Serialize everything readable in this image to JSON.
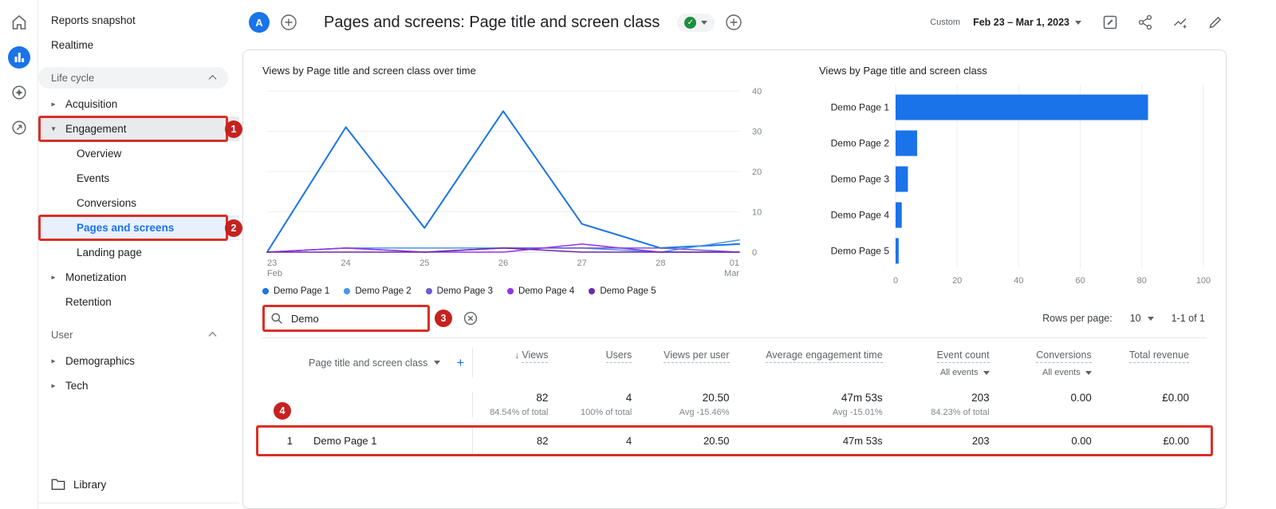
{
  "colors": {
    "blue": "#1a73e8",
    "light_blue_bg": "#e8f0fe",
    "selected_gray": "#e8eaed",
    "annotation_box_red": "#d93025",
    "annotation_badge_red": "#c5221f",
    "green": "#1e8e3e",
    "text": "#202124",
    "muted": "#5f6368",
    "series": [
      "#1a73e8",
      "#4797e8",
      "#6f5bd0",
      "#9334e6",
      "#6d28a8"
    ]
  },
  "icons": {
    "check": "✓",
    "plus": "+",
    "sort_desc": "↓",
    "triangle_right": "▸",
    "triangle_down": "▾"
  },
  "rail": {
    "icons": [
      "home-icon",
      "reports-icon",
      "explore-icon",
      "advertising-icon"
    ]
  },
  "sidebar": {
    "reports_snapshot": "Reports snapshot",
    "realtime": "Realtime",
    "life_cycle": "Life cycle",
    "acquisition": "Acquisition",
    "engagement": "Engagement",
    "overview": "Overview",
    "events": "Events",
    "conversions": "Conversions",
    "pages_and_screens": "Pages and screens",
    "landing_page": "Landing page",
    "monetization": "Monetization",
    "retention": "Retention",
    "user": "User",
    "demographics": "Demographics",
    "tech": "Tech",
    "library": "Library"
  },
  "header": {
    "avatar_letter": "A",
    "title": "Pages and screens: Page title and screen class",
    "date_label": "Custom",
    "date_range": "Feb 23 – Mar 1, 2023"
  },
  "chart_data": [
    {
      "type": "line",
      "title": "Views by Page title and screen class over time",
      "x": [
        "23 Feb",
        "24",
        "25",
        "26",
        "27",
        "28",
        "01 Mar"
      ],
      "x_tick_labels": [
        [
          "23",
          "Feb"
        ],
        [
          "24"
        ],
        [
          "25"
        ],
        [
          "26"
        ],
        [
          "27"
        ],
        [
          "28"
        ],
        [
          "01",
          "Mar"
        ]
      ],
      "ylim": [
        0,
        40
      ],
      "yticks": [
        0,
        10,
        20,
        30,
        40
      ],
      "grid": true,
      "legend_position": "bottom",
      "series": [
        {
          "name": "Demo Page 1",
          "values": [
            0,
            31,
            6,
            35,
            7,
            1,
            2
          ]
        },
        {
          "name": "Demo Page 2",
          "values": [
            0,
            1,
            1,
            1,
            1,
            0,
            3
          ]
        },
        {
          "name": "Demo Page 3",
          "values": [
            0,
            1,
            0,
            1,
            1,
            1,
            0
          ]
        },
        {
          "name": "Demo Page 4",
          "values": [
            0,
            1,
            0,
            0,
            2,
            0,
            0
          ]
        },
        {
          "name": "Demo Page 5",
          "values": [
            0,
            0,
            0,
            1,
            0,
            0,
            0
          ]
        }
      ]
    },
    {
      "type": "bar",
      "orientation": "horizontal",
      "title": "Views by Page title and screen class",
      "categories": [
        "Demo Page 1",
        "Demo Page 2",
        "Demo Page 3",
        "Demo Page 4",
        "Demo Page 5"
      ],
      "values": [
        82,
        7,
        4,
        2,
        1
      ],
      "xlim": [
        0,
        100
      ],
      "xticks": [
        0,
        20,
        40,
        60,
        80,
        100
      ],
      "grid": true
    }
  ],
  "table": {
    "search_value": "Demo",
    "rows_per_page_label": "Rows per page:",
    "rows_per_page_value": "10",
    "pagination": "1-1 of 1",
    "dimension_header": "Page title and screen class",
    "columns": [
      "Views",
      "Users",
      "Views per user",
      "Average engagement time",
      "Event count",
      "Conversions",
      "Total revenue"
    ],
    "all_events": "All events",
    "totals": [
      {
        "v": "82",
        "sub": "84.54% of total"
      },
      {
        "v": "4",
        "sub": "100% of total"
      },
      {
        "v": "20.50",
        "sub": "Avg -15.46%"
      },
      {
        "v": "47m 53s",
        "sub": "Avg -15.01%"
      },
      {
        "v": "203",
        "sub": "84.23% of total"
      },
      {
        "v": "0.00",
        "sub": ""
      },
      {
        "v": "£0.00",
        "sub": ""
      }
    ],
    "rows": [
      {
        "index": "1",
        "name": "Demo Page 1",
        "cells": [
          "82",
          "4",
          "20.50",
          "47m 53s",
          "203",
          "0.00",
          "£0.00"
        ]
      }
    ]
  },
  "annotations": {
    "n1": "1",
    "n2": "2",
    "n3": "3",
    "n4": "4"
  }
}
